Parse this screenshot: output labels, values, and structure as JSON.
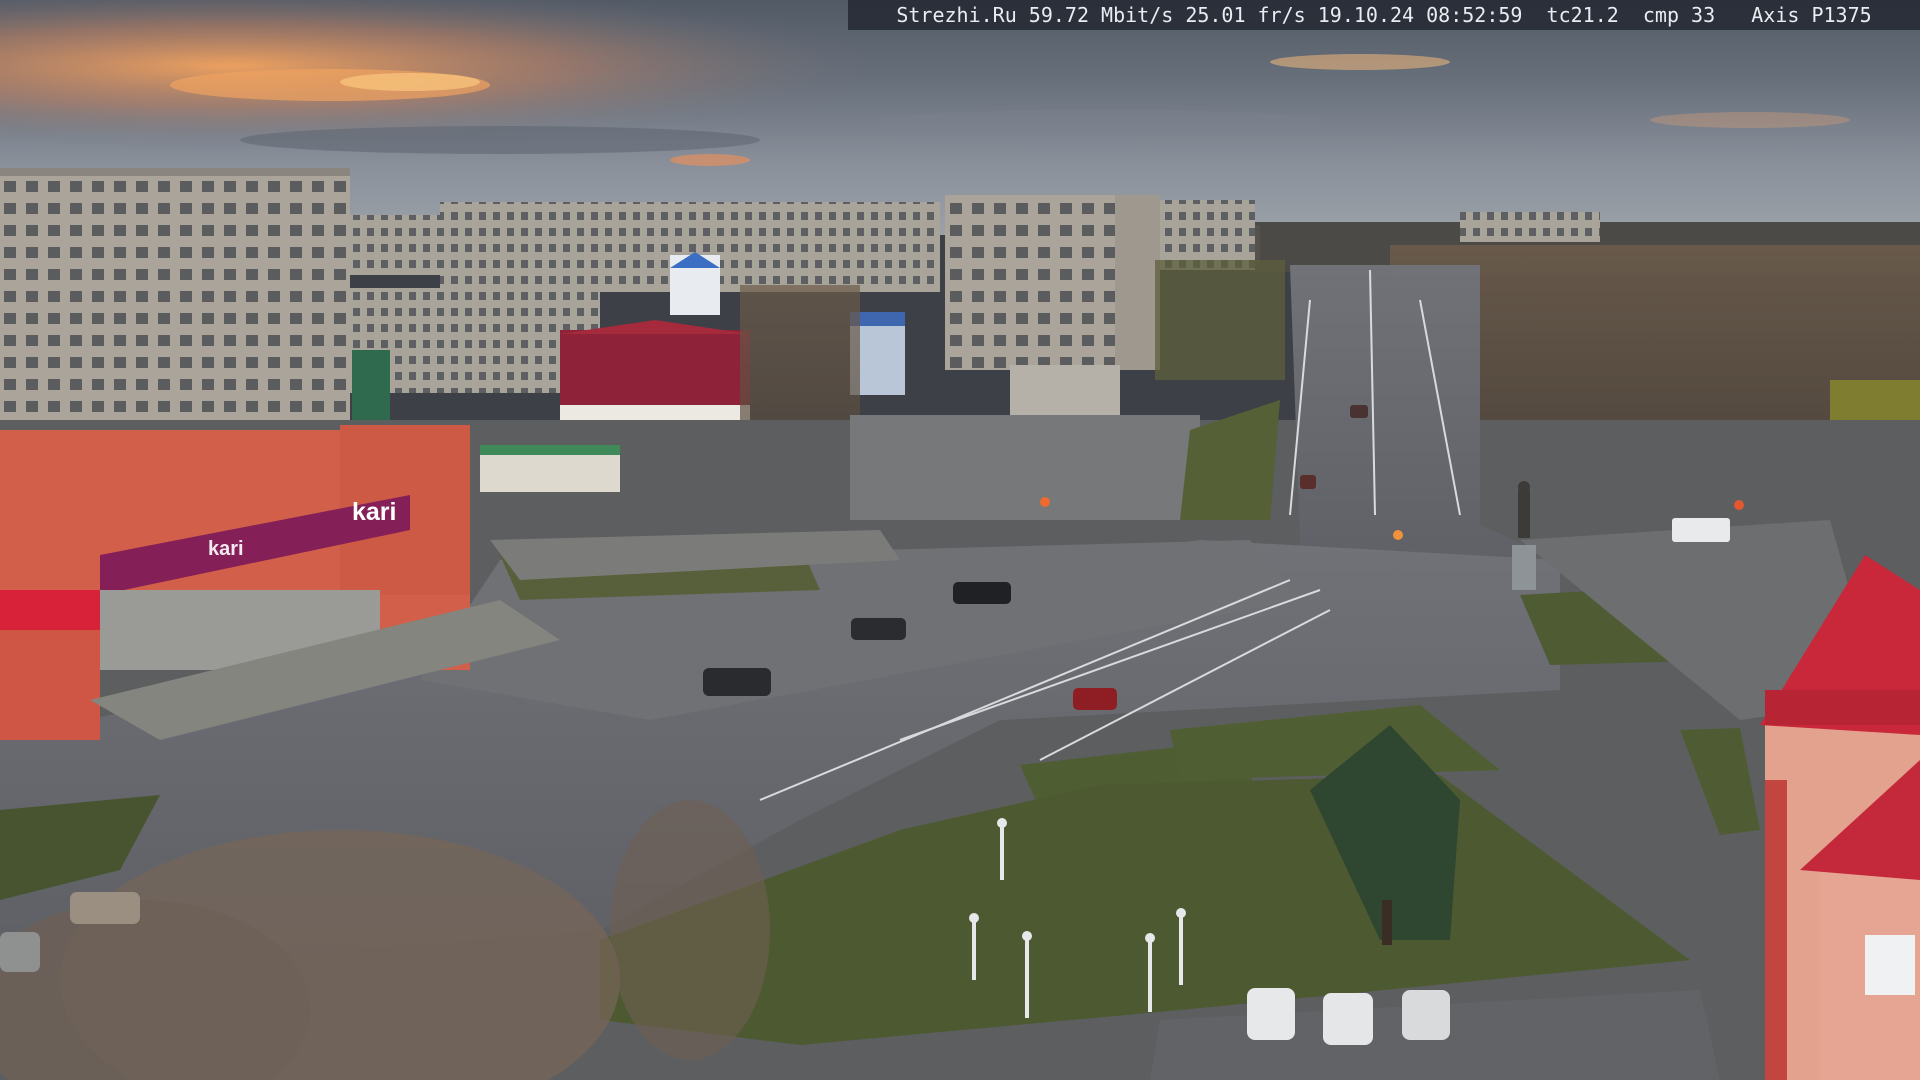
{
  "camera_overlay": {
    "text": "Strezhi.Ru 59.72 Mbit/s 25.01 fr/s 19.10.24 08:52:59  tc21.2  cmp 33   Axis P1375",
    "background": "#222630",
    "color": "#e9ecf1"
  },
  "scene": {
    "description_icon": "city-street-webcam-view",
    "store_sign": "kari",
    "store_sign_secondary": "kari",
    "palette": {
      "sky_top": "#4f5866",
      "sky_glow": "#e8915a",
      "road": "#6b6d72",
      "grass": "#4d5a33",
      "store_wall": "#d55f4a",
      "store_band": "#8a1f58",
      "panel_block": "#a9a398",
      "roof_red": "#b12a3a"
    }
  }
}
